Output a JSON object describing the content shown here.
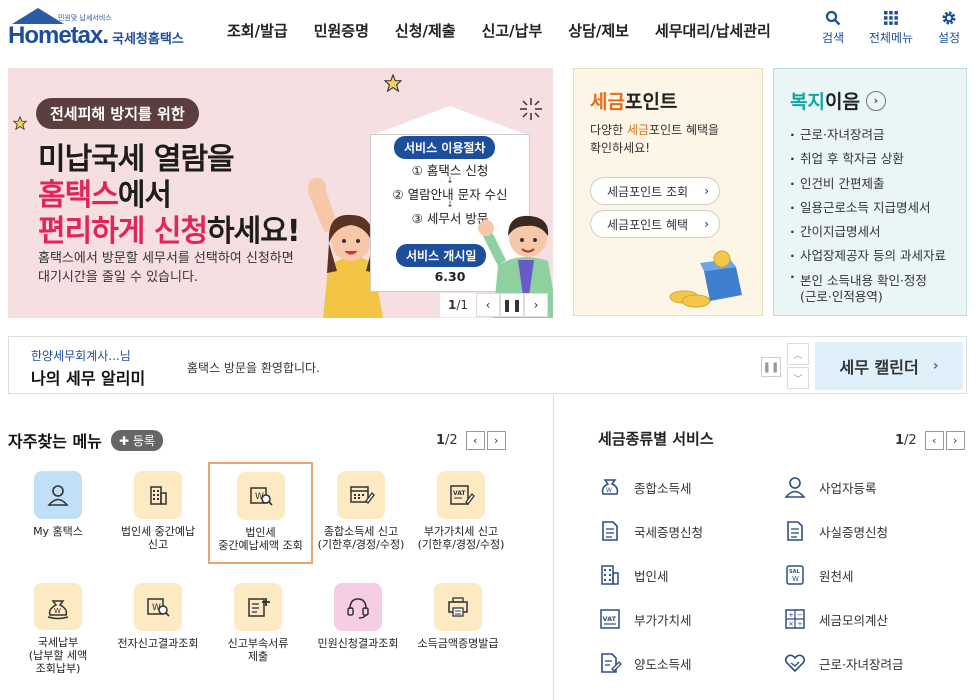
{
  "header": {
    "logo_sub": "민원맞 납세서비스",
    "logo_text": "Hometax.",
    "logo_kr": "국세청홈택스",
    "gnb": [
      "조회/발급",
      "민원증명",
      "신청/제출",
      "신고/납부",
      "상담/제보",
      "세무대리/납세관리"
    ],
    "util": {
      "search": "검색",
      "menu": "전체메뉴",
      "settings": "설정"
    }
  },
  "banner": {
    "tag": "전세피해 방지를 위한",
    "line1": "미납국세 열람을",
    "line2_pink": "홈택스",
    "line2_rest": "에서",
    "line3_pink": "편리하게 신청",
    "line3_rest": "하세요!",
    "desc1": "홈택스에서 방문할 세무서를 선택하여 신청하면",
    "desc2": "대기시간을 줄일 수 있습니다.",
    "procedure_label": "서비스 이용절차",
    "steps": [
      "① 홈택스 신청",
      "② 열람안내 문자 수신",
      "③ 세무서 방문"
    ],
    "start_label": "서비스 개시일",
    "start_date": "6.30",
    "page_current": "1",
    "page_total": "/1"
  },
  "point": {
    "title_orange": "세금",
    "title_rest": "포인트",
    "desc1_pre": "다양한 ",
    "desc1_orange": "세금",
    "desc1_post": "포인트 혜택을",
    "desc2": "확인하세요!",
    "btn1": "세금포인트 조회",
    "btn2": "세금포인트 혜택"
  },
  "welfare": {
    "title_teal": "복지",
    "title_rest": "이음",
    "items": [
      "근로·자녀장려금",
      "취업 후 학자금 상환",
      "인건비 간편제출",
      "일용근로소득 지급명세서",
      "간이지급명세서",
      "사업장제공자 등의 과세자료"
    ],
    "last_item_1": "본인 소득내용 확인·정정",
    "last_item_2": "(근로·인적용역)"
  },
  "notice": {
    "user": "한양세무회계사...님",
    "title": "나의 세무 알리미",
    "message": "홈택스 방문을 환영합니다.",
    "calendar": "세무 캘린더"
  },
  "frequent": {
    "title": "자주찾는 메뉴",
    "register": "등록",
    "page_current": "1",
    "page_total": "/2",
    "tiles": [
      {
        "label": "My 홈택스"
      },
      {
        "label": "법인세 중간예납\n신고"
      },
      {
        "label": "법인세\n중간예납세액 조회"
      },
      {
        "label": "종합소득세 신고\n(기한후/경정/수정)"
      },
      {
        "label": "부가가치세 신고\n(기한후/경정/수정)"
      },
      {
        "label": "국세납부\n(납부할 세액\n조회납부)"
      },
      {
        "label": "전자신고결과조회"
      },
      {
        "label": "신고부속서류\n제출"
      },
      {
        "label": "민원신청결과조회"
      },
      {
        "label": "소득금액증명발급"
      }
    ]
  },
  "tax_services": {
    "title": "세금종류별 서비스",
    "page_current": "1",
    "page_total": "/2",
    "items": [
      "종합소득세",
      "사업자등록",
      "국세증명신청",
      "사실증명신청",
      "법인세",
      "원천세",
      "부가가치세",
      "세금모의계산",
      "양도소득세",
      "근로·자녀장려금"
    ]
  },
  "colors": {
    "brand": "#1d4e9b",
    "accent_pink": "#e2245b",
    "accent_orange": "#e86b17",
    "accent_teal": "#11a6a0"
  }
}
